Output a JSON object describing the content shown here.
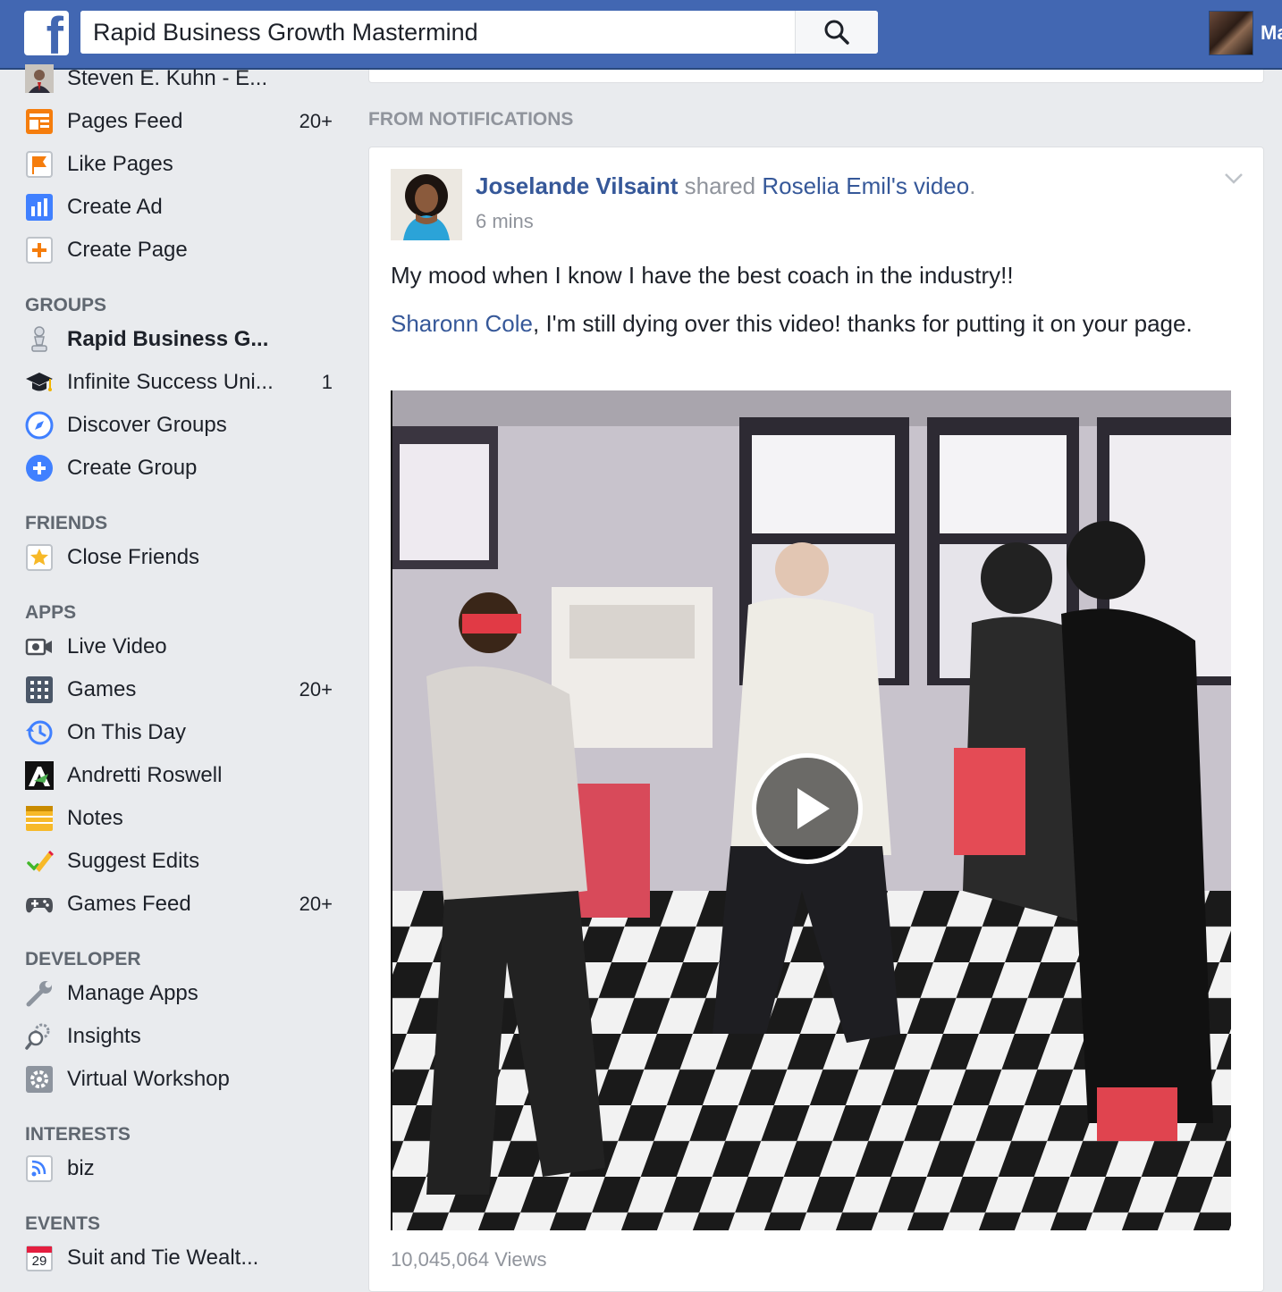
{
  "topbar": {
    "search_value": "Rapid Business Growth Mastermind",
    "search_placeholder": "Search",
    "user_name_partial": "Ma"
  },
  "colors": {
    "brand": "#4267b2",
    "link": "#365899",
    "muted": "#90949c",
    "page_bg": "#e9ebee"
  },
  "nav": {
    "shortcuts": [
      {
        "label": "Steven E. Kuhn - E...",
        "count": "",
        "icon": "profile-photo-icon"
      },
      {
        "label": "Pages Feed",
        "count": "20+",
        "icon": "pages-feed-icon"
      },
      {
        "label": "Like Pages",
        "count": "",
        "icon": "flag-icon"
      },
      {
        "label": "Create Ad",
        "count": "",
        "icon": "bar-chart-icon"
      },
      {
        "label": "Create Page",
        "count": "",
        "icon": "plus-page-icon"
      }
    ],
    "groups_heading": "GROUPS",
    "groups": [
      {
        "label": "Rapid Business G...",
        "count": "",
        "icon": "chess-pawn-icon"
      },
      {
        "label": "Infinite Success Uni...",
        "count": "1",
        "icon": "graduation-cap-icon"
      },
      {
        "label": "Discover Groups",
        "count": "",
        "icon": "compass-icon"
      },
      {
        "label": "Create Group",
        "count": "",
        "icon": "plus-circle-icon"
      }
    ],
    "friends_heading": "FRIENDS",
    "friends": [
      {
        "label": "Close Friends",
        "count": "",
        "icon": "star-icon"
      }
    ],
    "apps_heading": "APPS",
    "apps": [
      {
        "label": "Live Video",
        "count": "",
        "icon": "video-camera-icon"
      },
      {
        "label": "Games",
        "count": "20+",
        "icon": "games-grid-icon"
      },
      {
        "label": "On This Day",
        "count": "",
        "icon": "clock-history-icon"
      },
      {
        "label": "Andretti Roswell",
        "count": "",
        "icon": "app-logo-icon"
      },
      {
        "label": "Notes",
        "count": "",
        "icon": "notes-icon"
      },
      {
        "label": "Suggest Edits",
        "count": "",
        "icon": "pencil-check-icon"
      },
      {
        "label": "Games Feed",
        "count": "20+",
        "icon": "gamepad-icon"
      }
    ],
    "developer_heading": "DEVELOPER",
    "developer": [
      {
        "label": "Manage Apps",
        "count": "",
        "icon": "wrench-icon"
      },
      {
        "label": "Insights",
        "count": "",
        "icon": "gear-magnifier-icon"
      },
      {
        "label": "Virtual Workshop",
        "count": "",
        "icon": "gear-icon"
      }
    ],
    "interests_heading": "INTERESTS",
    "interests": [
      {
        "label": "biz",
        "count": "",
        "icon": "rss-icon"
      }
    ],
    "events_heading": "EVENTS",
    "events": [
      {
        "label": "Suit and Tie Wealt...",
        "count": "",
        "icon": "calendar-icon",
        "date": "29"
      }
    ]
  },
  "feed": {
    "section_label": "FROM NOTIFICATIONS",
    "post": {
      "author": "Joselande Vilsaint",
      "verb": " shared ",
      "shared_from": "Roselia Emil",
      "possessive": "'s ",
      "object": "video",
      "period": ".",
      "time": "6 mins",
      "text_line1": "My mood when I know I have the best coach in the industry!!",
      "mention": "Sharonn Cole",
      "text_line2_rest": ", I'm still dying over this video! thanks for putting it on your page.",
      "views": "10,045,064 Views"
    }
  }
}
